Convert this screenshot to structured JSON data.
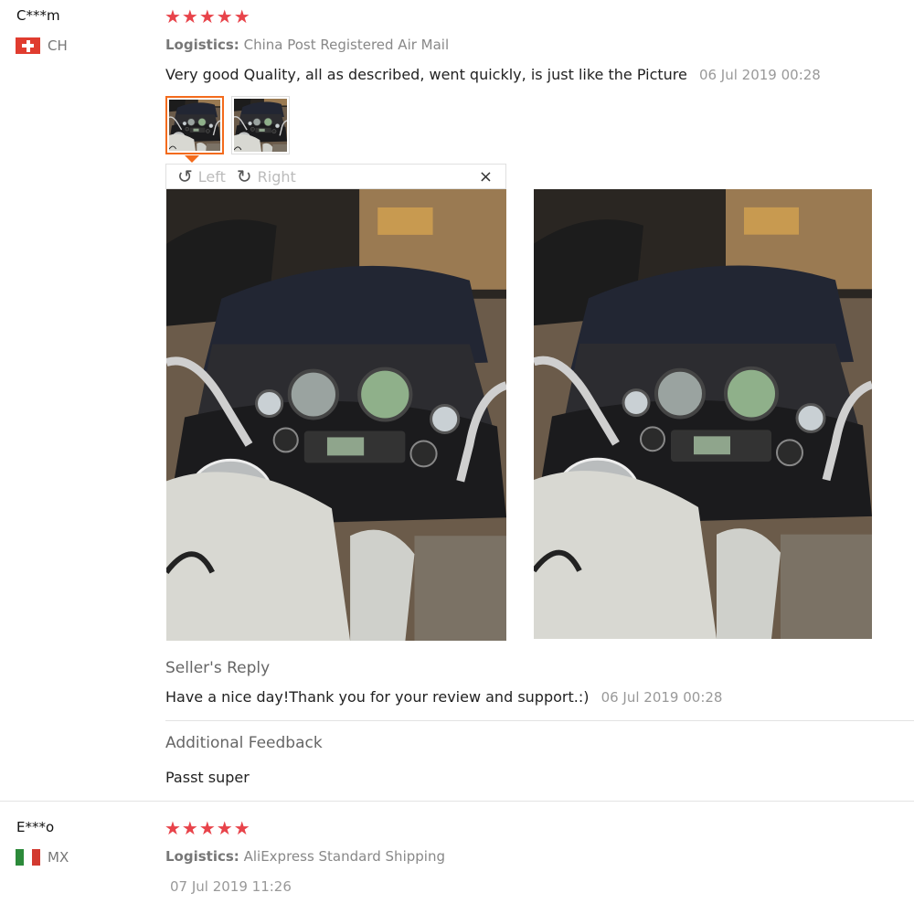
{
  "reviews": [
    {
      "user": "C***m",
      "country": "CH",
      "stars": "★★★★★",
      "logistics_label": "Logistics:",
      "logistics_value": "China Post Registered Air Mail",
      "text": "Very good Quality, all as described, went quickly, is just like the Picture",
      "date": "06 Jul 2019 00:28",
      "viewer": {
        "left": "Left",
        "right": "Right",
        "close": "×"
      },
      "seller_reply_label": "Seller's Reply",
      "seller_reply_text": "Have a nice day!Thank you for your review and support.:)",
      "seller_reply_date": "06 Jul 2019 00:28",
      "additional_label": "Additional Feedback",
      "additional_text": "Passt super"
    },
    {
      "user": "E***o",
      "country": "MX",
      "stars": "★★★★★",
      "logistics_label": "Logistics:",
      "logistics_value": "AliExpress Standard Shipping",
      "date": "07 Jul 2019 11:26"
    }
  ],
  "colors": {
    "star": "#e8434a",
    "thumb_active": "#f36b1c"
  },
  "icons": {
    "rotate_left": "rotate-left-icon",
    "rotate_right": "rotate-right-icon",
    "close": "close-icon"
  }
}
